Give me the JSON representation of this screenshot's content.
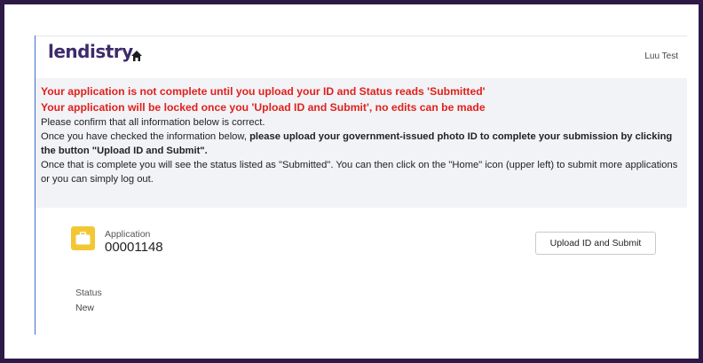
{
  "header": {
    "logo_text": "lendistry",
    "home_icon": "home-icon",
    "user_name": "Luu Test"
  },
  "notice": {
    "warning_1": "Your application is not complete until you upload your ID and Status reads 'Submitted'",
    "warning_2": "Your application will be locked once you 'Upload ID and Submit', no edits can be made",
    "line_1": "Please confirm that all information below is correct.",
    "line_2_start": "Once you have checked the information below, ",
    "line_2_bold": "please upload your government-issued photo ID to complete your submission by clicking the button \"Upload ID and Submit\".",
    "line_3": "Once that is complete you will see the status listed as \"Submitted\". You can then click on the \"Home\" icon (upper left) to submit more applications or you can simply log out."
  },
  "record": {
    "icon": "briefcase-icon",
    "icon_color": "#f3c634",
    "label": "Application",
    "number": "00001148",
    "upload_button": "Upload ID and Submit"
  },
  "status": {
    "label": "Status",
    "value": "New"
  },
  "colors": {
    "warning": "#e0211b",
    "brand": "#3d2b6b",
    "frame": "#2e1a47"
  }
}
